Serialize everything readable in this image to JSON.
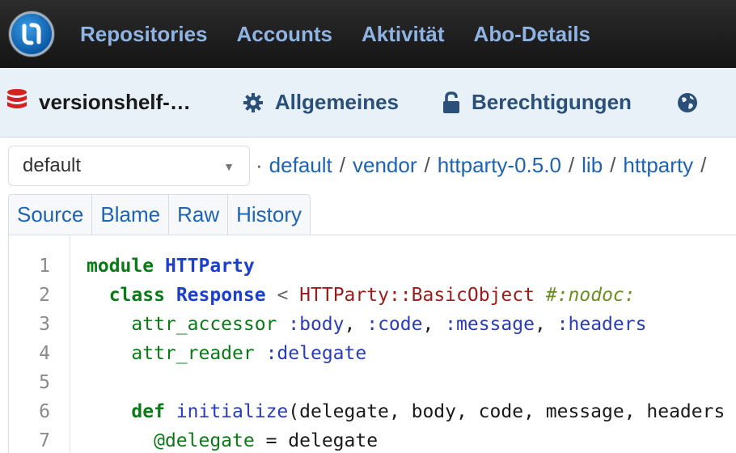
{
  "topnav": {
    "items": [
      "Repositories",
      "Accounts",
      "Aktivität",
      "Abo-Details"
    ]
  },
  "subnav": {
    "repo_name": "versionshelf-…",
    "tabs": [
      "Allgemeines",
      "Berechtigungen"
    ]
  },
  "branch": {
    "selected": "default"
  },
  "breadcrumb": {
    "prefix": "·",
    "parts": [
      "default",
      "vendor",
      "httparty-0.5.0",
      "lib",
      "httparty"
    ],
    "trailing": "/"
  },
  "file_tabs": [
    "Source",
    "Blame",
    "Raw",
    "History"
  ],
  "code": {
    "line_numbers": [
      "1",
      "2",
      "3",
      "4",
      "5",
      "6",
      "7"
    ],
    "l1": {
      "kw": "module",
      "name": "HTTParty"
    },
    "l2": {
      "kw": "class",
      "name": "Response",
      "op": "<",
      "parent": "HTTParty::BasicObject",
      "comment": "#:nodoc:"
    },
    "l3": {
      "method": "attr_accessor",
      "args": [
        ":body",
        ":code",
        ":message",
        ":headers"
      ]
    },
    "l4": {
      "method": "attr_reader",
      "args": [
        ":delegate"
      ]
    },
    "l6": {
      "kw": "def",
      "name": "initialize",
      "params": "(delegate, body, code, message, headers"
    },
    "l7": {
      "ivar": "@delegate",
      "op": "=",
      "value": "delegate"
    }
  },
  "colors": {
    "topnav_link": "#8fb3e3",
    "subnav_bg": "#e8f1f8",
    "subnav_link": "#2a4f78",
    "link": "#1f63b5",
    "keyword": "#0a7a16",
    "constant": "#1b3fd1",
    "db_icon": "#d62020"
  }
}
